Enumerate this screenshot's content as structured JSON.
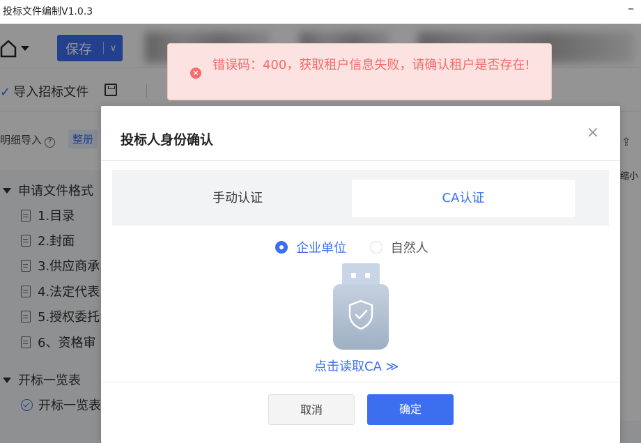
{
  "window": {
    "title": "投标文件编制V1.0.3",
    "minimize": "–"
  },
  "toolbar": {
    "save_label": "保存",
    "save_arrow": "∨"
  },
  "subtoolbar": {
    "import_label": "导入招标文件",
    "import_pen": "✓"
  },
  "row3": {
    "detail_import": "明细导入",
    "help_mark": "?",
    "tag": "整册"
  },
  "tree": {
    "group1": "申请文件格式",
    "items": [
      "1.目录",
      "2.封面",
      "3.供应商承",
      "4.法定代表",
      "5.授权委托",
      "6、资格审"
    ],
    "group2": "开标一览表",
    "item2": "开标一览表"
  },
  "right_panel": {
    "upload": "⇪",
    "shrink": "缩小"
  },
  "toast": {
    "icon": "×",
    "message": "错误码：400，获取租户信息失败，请确认租户是否存在!",
    "color": "#f56c6c"
  },
  "dialog": {
    "title": "投标人身份确认",
    "close": "×",
    "tabs": [
      {
        "label": "手动认证",
        "active": false
      },
      {
        "label": "CA认证",
        "active": true
      }
    ],
    "radio_options": [
      {
        "label": "企业单位",
        "checked": true
      },
      {
        "label": "自然人",
        "checked": false
      }
    ],
    "read_ca_label": "点击读取CA ≫",
    "cancel_label": "取消",
    "confirm_label": "确定",
    "accent_color": "#3b6ff0"
  }
}
